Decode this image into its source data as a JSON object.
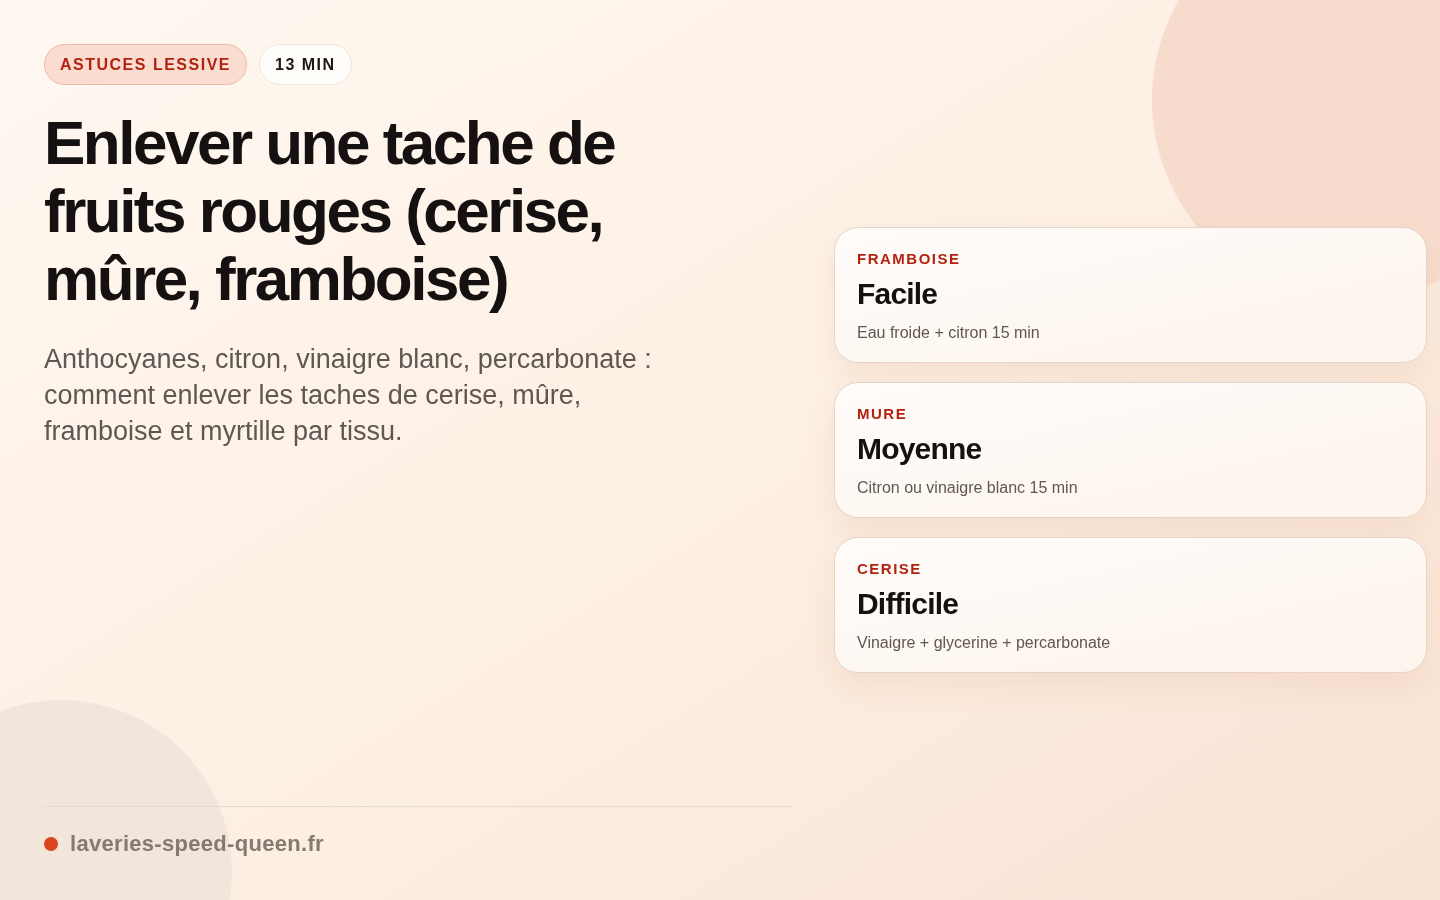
{
  "tags": [
    {
      "label": "ASTUCES LESSIVE",
      "kind": "category"
    },
    {
      "label": "13 MIN",
      "kind": "duration"
    }
  ],
  "title": "Enlever une tache de fruits rouges (cerise, mûre, framboise)",
  "subtitle": "Anthocyanes, citron, vinaigre blanc, percarbonate : comment enlever les taches de cerise, mûre, framboise et myrtille par tissu.",
  "cards": [
    {
      "fruit": "FRAMBOISE",
      "difficulty": "Facile",
      "method": "Eau froide + citron 15 min"
    },
    {
      "fruit": "MURE",
      "difficulty": "Moyenne",
      "method": "Citron ou vinaigre blanc 15 min"
    },
    {
      "fruit": "CERISE",
      "difficulty": "Difficile",
      "method": "Vinaigre + glycerine + percarbonate"
    }
  ],
  "footer": {
    "site": "laveries-speed-queen.fr"
  }
}
